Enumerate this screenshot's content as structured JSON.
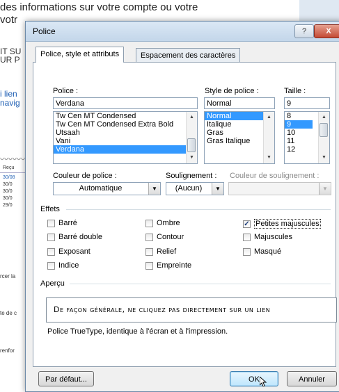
{
  "background": {
    "line1": "des informations sur votre compte ou votre",
    "line2": "votr",
    "side_text": [
      "IT SU",
      "UR P",
      "i lien",
      "navig"
    ],
    "wave": "〰〰〰",
    "recu": "Reçu",
    "dates": [
      "30/08",
      "30/0",
      "30/0",
      "30/0",
      "29/0"
    ],
    "left_notes": [
      "rcer la",
      "te de c",
      "renfor"
    ]
  },
  "dialog": {
    "title": "Police",
    "help_label": "?",
    "close_label": "X",
    "tabs": [
      {
        "label": "Police, style et attributs",
        "active": true
      },
      {
        "label": "Espacement des caractères",
        "active": false
      }
    ],
    "font": {
      "label": "Police :",
      "value": "Verdana",
      "options": [
        "Tw Cen MT Condensed",
        "Tw Cen MT Condensed Extra Bold",
        "Utsaah",
        "Vani",
        "Verdana"
      ],
      "selected": "Verdana"
    },
    "style": {
      "label": "Style de police :",
      "value": "Normal",
      "options": [
        "Normal",
        "Italique",
        "Gras",
        "Gras Italique"
      ],
      "selected": "Normal"
    },
    "size": {
      "label": "Taille :",
      "value": "9",
      "options": [
        "8",
        "9",
        "10",
        "11",
        "12"
      ],
      "selected": "9"
    },
    "font_color": {
      "label": "Couleur de police :",
      "value": "Automatique"
    },
    "underline": {
      "label": "Soulignement :",
      "value": "(Aucun)"
    },
    "underline_color": {
      "label": "Couleur de soulignement :",
      "value": ""
    },
    "effects": {
      "label": "Effets",
      "items": [
        {
          "label": "Barré",
          "checked": false
        },
        {
          "label": "Ombre",
          "checked": false
        },
        {
          "label": "Petites majuscules",
          "checked": true
        },
        {
          "label": "Barré double",
          "checked": false
        },
        {
          "label": "Contour",
          "checked": false
        },
        {
          "label": "Majuscules",
          "checked": false
        },
        {
          "label": "Exposant",
          "checked": false
        },
        {
          "label": "Relief",
          "checked": false
        },
        {
          "label": "Masqué",
          "checked": false
        },
        {
          "label": "Indice",
          "checked": false
        },
        {
          "label": "Empreinte",
          "checked": false
        }
      ]
    },
    "preview": {
      "label": "Aperçu",
      "text": "De façon générale, ne cliquez pas directement sur un lien",
      "note": "Police TrueType, identique à l'écran et à l'impression."
    },
    "buttons": {
      "default": "Par défaut...",
      "ok": "OK",
      "cancel": "Annuler"
    }
  }
}
